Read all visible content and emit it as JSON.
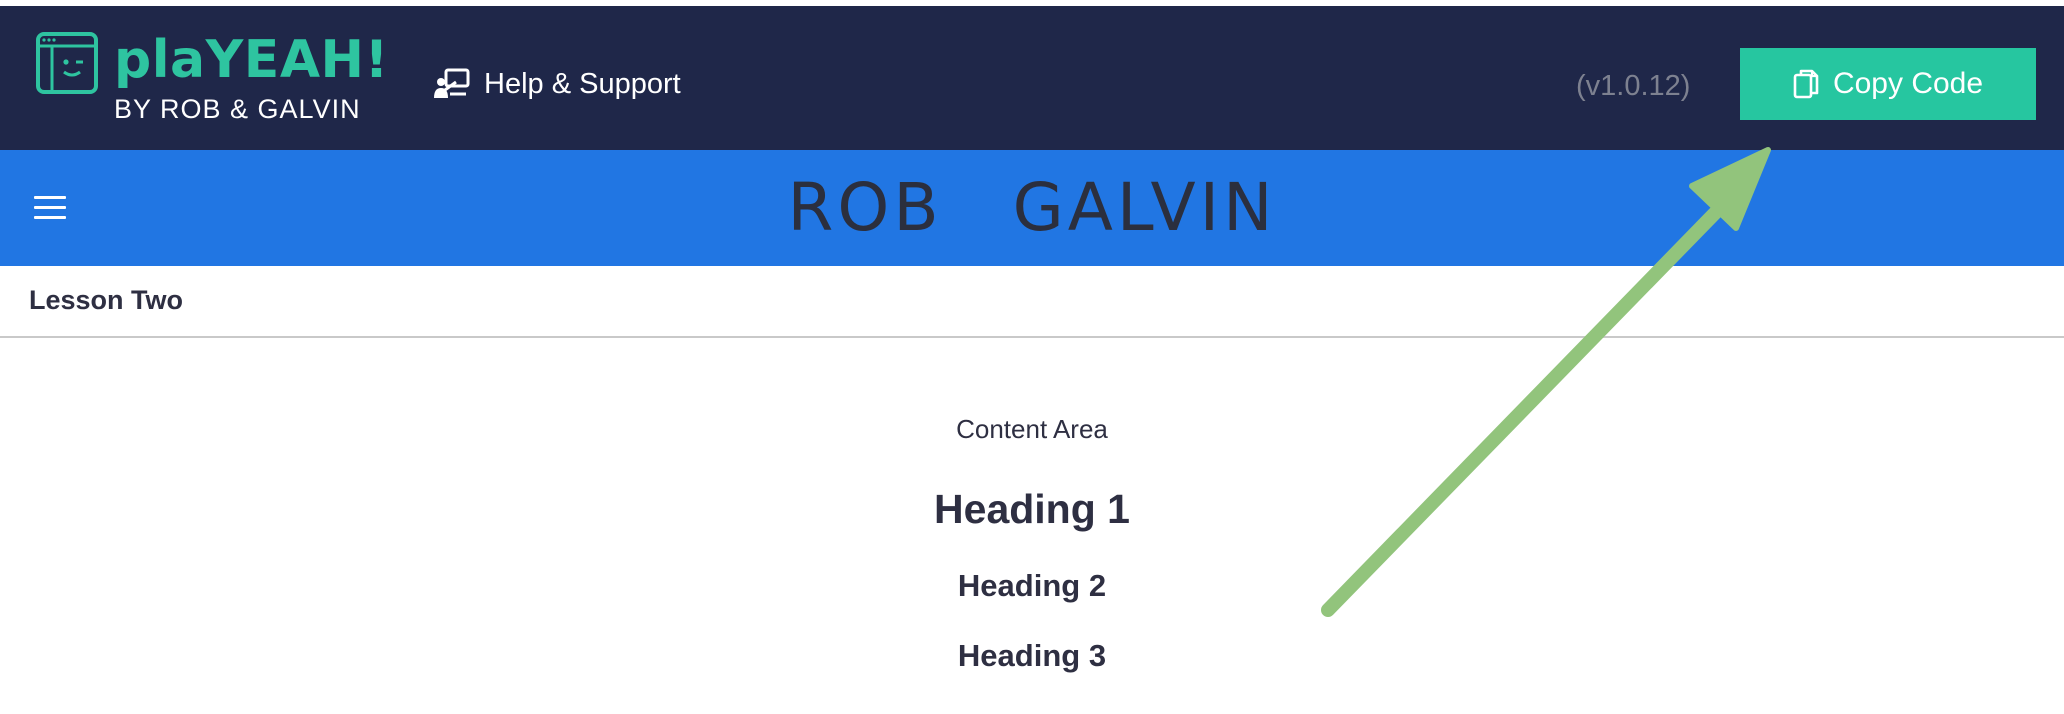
{
  "header": {
    "logo_title": "plaYEAH!",
    "logo_subtitle": "BY ROB & GALVIN",
    "help_label": "Help & Support",
    "version": "(v1.0.12)",
    "copy_button_label": "Copy Code"
  },
  "brand_bar": {
    "brand_left": "ROB",
    "brand_right": "GALVIN"
  },
  "lesson": {
    "title": "Lesson Two"
  },
  "content": {
    "label": "Content Area",
    "heading1": "Heading 1",
    "heading2": "Heading 2",
    "heading3": "Heading 3"
  },
  "icons": {
    "logo": "browser-face-icon",
    "help": "presenter-icon",
    "copy": "copy-icon",
    "menu": "hamburger-menu-icon"
  },
  "colors": {
    "header_bg": "#1f2749",
    "brand_bar_bg": "#2176e3",
    "accent": "#26c6a0",
    "text_dark": "#2e2f42",
    "annotation_arrow": "#92c47c"
  }
}
